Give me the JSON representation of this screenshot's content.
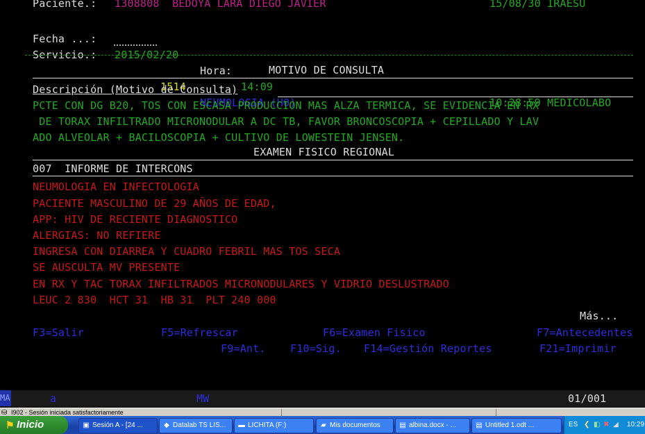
{
  "terminal": {
    "header": {
      "paciente_label": "Paciente.:",
      "paciente_value": "1308808  BEDOYA LARA DIEGO JAVIER",
      "paciente_right": "15/08/30 IRAESU",
      "fecha_label": "Fecha ...:",
      "fecha_value": "2015/02/20",
      "hora_label": "Hora:",
      "hora_value": "14:09",
      "time_right": "10:28:59 MEDICOLABO",
      "servicio_label": "Servicio.:",
      "servicio_code": "1514",
      "servicio_name": "NEUMOLOGIA (HO)"
    },
    "motivo": {
      "title": "MOTIVO DE CONSULTA",
      "desc_label": "Descripción (Motivo de Consulta)",
      "lines": [
        "PCTE CON DG B20, TOS CON ESCASA PRODUCCION MAS ALZA TERMICA, SE EVIDENCIA EN RX",
        " DE TORAX INFILTRADO MICRONODULAR A DC TB, FAVOR BRONCOSCOPIA + CEPILLADO Y LAV",
        "ADO ALVEOLAR + BACILOSCOPIA + CULTIVO DE LOWESTEIN JENSEN."
      ]
    },
    "examen": {
      "title": "EXAMEN FISICO REGIONAL",
      "subtitle": "007  INFORME DE INTERCONS",
      "lines": [
        "NEUMOLOGIA EN INFECTOLOGIA",
        "PACIENTE MASCULINO DE 29 AÑOS DE EDAD,",
        "APP: HIV DE RECIENTE DIAGNOSTICO",
        "ALERGIAS: NO REFIERE",
        "INGRESA CON DIARREA Y CUADRO FEBRIL MAS TOS SECA",
        "SE AUSCULTA MV PRESENTE",
        "EN RX Y TAC TORAX INFILTRADOS MICRONODULARES Y VIDRIO DESLUSTRADO",
        "LEUC 2 830  HCT 31  HB 31  PLT 240 000"
      ]
    },
    "mas": "Más...",
    "fkeys": {
      "f3": "F3=Salir",
      "f5": "F5=Refrescar",
      "f6": "F6=Examen Fisico",
      "f7": "F7=Antecedentes",
      "f9": "F9=Ant.",
      "f10": "F10=Sig.",
      "f14": "F14=Gestión Reportes",
      "f21": "F21=Imprimir"
    },
    "status": {
      "ma": "MA",
      "a": "a",
      "mw": "MW",
      "page": "01/001"
    }
  },
  "statusbar": {
    "text": "I902 - Sesión iniciada satisfactoriamente"
  },
  "taskbar": {
    "start": "Inicio",
    "items": [
      {
        "label": "Sesión A - [24 ...",
        "icon": "terminal-icon"
      },
      {
        "label": "Datalab TS LIS...",
        "icon": "app-icon"
      },
      {
        "label": "LICHITA (F:)",
        "icon": "drive-icon"
      },
      {
        "label": "Mis documentos",
        "icon": "folder-icon"
      },
      {
        "label": "albina.docx - ...",
        "icon": "document-icon"
      },
      {
        "label": "Untitled 1.odt ...",
        "icon": "document-icon"
      }
    ],
    "lang": "ES",
    "clock": "10:29"
  }
}
